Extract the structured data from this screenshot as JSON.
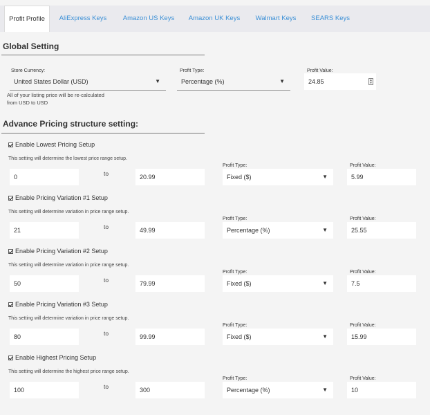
{
  "tabs": [
    "Profit Profile",
    "AliExpress Keys",
    "Amazon US Keys",
    "Amazon UK Keys",
    "Walmart Keys",
    "SEARS Keys"
  ],
  "active_tab": 0,
  "global": {
    "title": "Global Setting",
    "currency_label": "Store Currency:",
    "currency_value": "United States Dollar (USD)",
    "profit_type_label": "Profit Type:",
    "profit_type_value": "Percentage (%)",
    "profit_value_label": "Profit Value:",
    "profit_value": "24.85",
    "note_line1": "All of your listing price will be re-calculated",
    "note_line2": "from USD to USD"
  },
  "advance": {
    "title": "Advance Pricing structure setting:",
    "to_label": "to",
    "profit_type_label": "Profit Type:",
    "profit_value_label": "Profit Value:",
    "rows": [
      {
        "heading": "Enable Lowest Pricing Setup",
        "desc": "This setting will determine the lowest price range setup.",
        "from": "0",
        "to": "20.99",
        "type": "Fixed ($)",
        "value": "5.99"
      },
      {
        "heading": "Enable Pricing Variation #1 Setup",
        "desc": "This setting will determine variation in price range setup.",
        "from": "21",
        "to": "49.99",
        "type": "Percentage (%)",
        "value": "25.55"
      },
      {
        "heading": "Enable Pricing Variation #2 Setup",
        "desc": "This setting will determine variation in price range setup.",
        "from": "50",
        "to": "79.99",
        "type": "Fixed ($)",
        "value": "7.5"
      },
      {
        "heading": "Enable Pricing Variation #3 Setup",
        "desc": "This setting will determine variation in price range setup.",
        "from": "80",
        "to": "99.99",
        "type": "Fixed ($)",
        "value": "15.99"
      },
      {
        "heading": "Enable Highest Pricing Setup",
        "desc": "This setting will determine the highest price range setup.",
        "from": "100",
        "to": "300",
        "type": "Percentage (%)",
        "value": "10"
      }
    ]
  },
  "icons": {
    "dropdown": "dropdown-arrow-icon",
    "checkbox": "checkbox-checked-icon",
    "stepper": "number-stepper-icon"
  }
}
